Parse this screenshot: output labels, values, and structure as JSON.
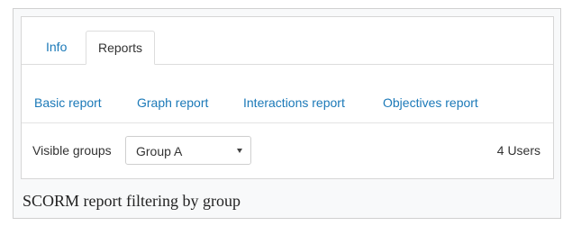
{
  "tabs": [
    {
      "label": "Info",
      "active": false
    },
    {
      "label": "Reports",
      "active": true
    }
  ],
  "subnav": [
    {
      "label": "Basic report"
    },
    {
      "label": "Graph report"
    },
    {
      "label": "Interactions report"
    },
    {
      "label": "Objectives report"
    }
  ],
  "filter": {
    "label": "Visible groups",
    "selected": "Group A",
    "icon": "chevron-down-icon"
  },
  "users_count": "4 Users",
  "caption": "SCORM report filtering by group",
  "colors": {
    "link": "#1b79b8",
    "text": "#333333",
    "border": "#dddddd",
    "frame_bg": "#f8f9fa"
  }
}
